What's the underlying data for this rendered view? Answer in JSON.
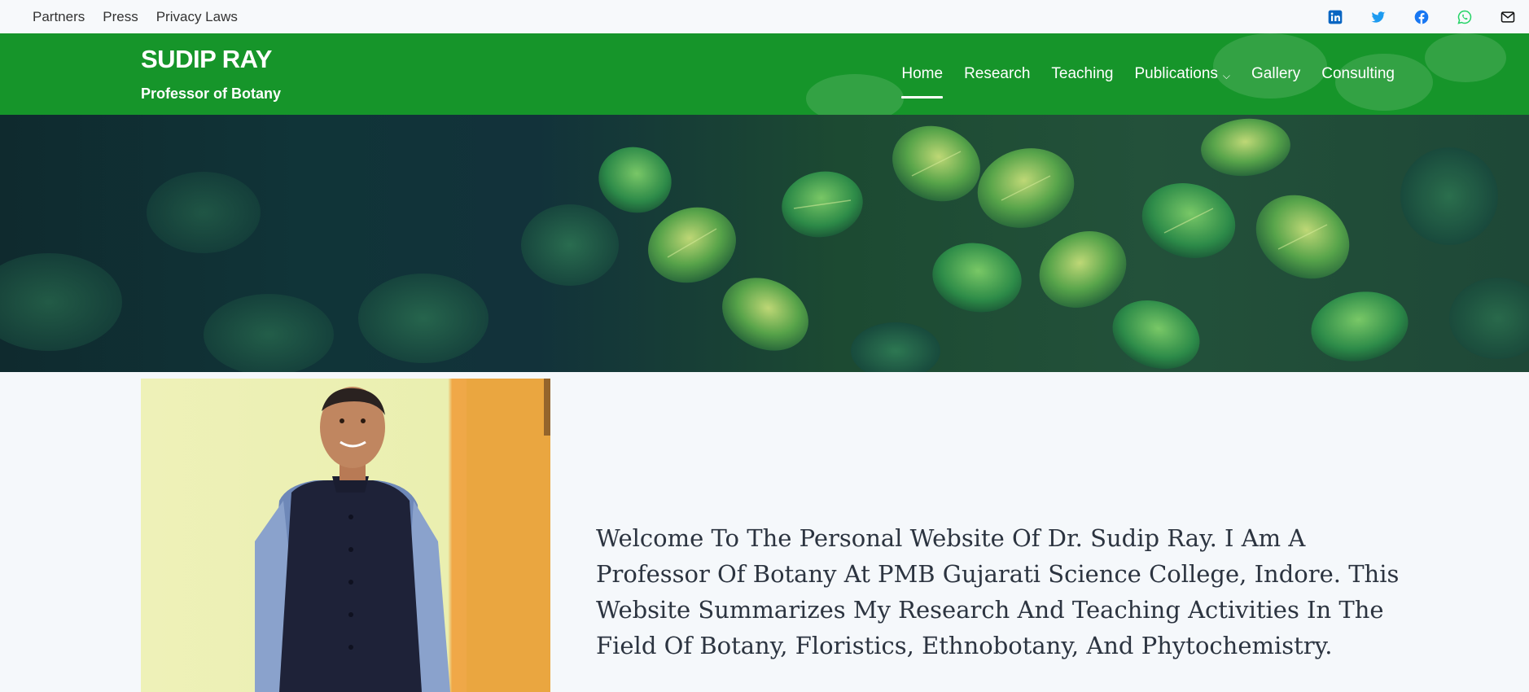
{
  "topbar": {
    "links": [
      "Partners",
      "Press",
      "Privacy Laws"
    ],
    "social_icons": [
      "linkedin-icon",
      "twitter-icon",
      "facebook-icon",
      "whatsapp-icon",
      "mail-icon"
    ]
  },
  "header": {
    "site_title": "SUDIP RAY",
    "tagline": "Professor of Botany",
    "nav": [
      {
        "label": "Home",
        "active": true
      },
      {
        "label": "Research"
      },
      {
        "label": "Teaching"
      },
      {
        "label": "Publications",
        "dropdown": true
      },
      {
        "label": "Gallery"
      },
      {
        "label": "Consulting"
      }
    ]
  },
  "colors": {
    "header_green": "#16952a",
    "linkedin": "#0a66c2",
    "twitter": "#1d9bf0",
    "facebook": "#1877f2",
    "whatsapp": "#25d366"
  },
  "main": {
    "welcome_text": "Welcome To The Personal Website Of Dr. Sudip Ray. I Am A Professor Of Botany At PMB Gujarati Science College, Indore. This Website Summarizes My Research And Teaching Activities In The Field Of Botany, Floristics, Ethnobotany, And Phytochemistry."
  }
}
